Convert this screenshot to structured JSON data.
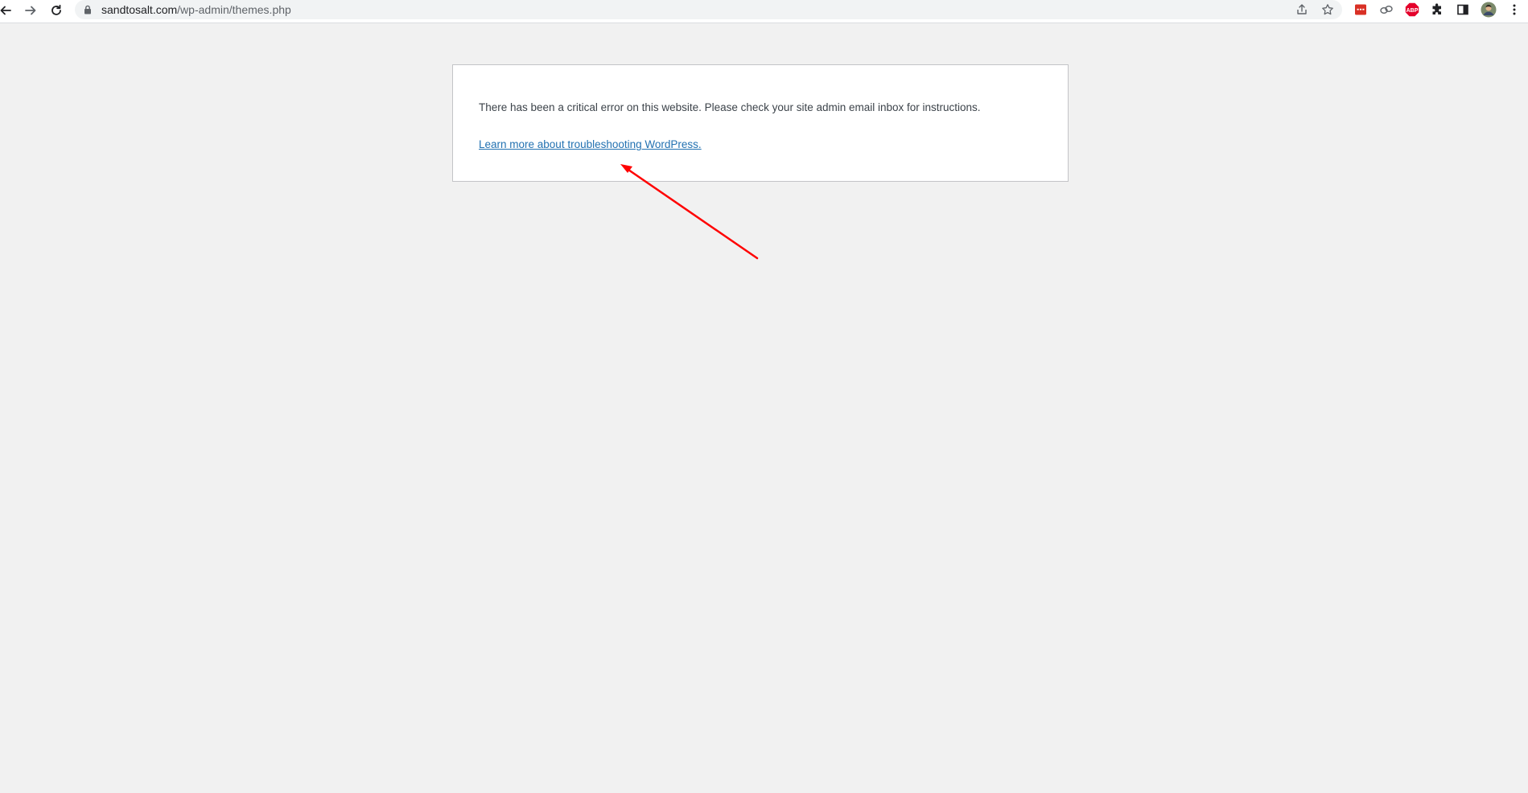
{
  "browser": {
    "url_domain": "sandtosalt.com",
    "url_path": "/wp-admin/themes.php",
    "icons": {
      "back": "back-arrow-icon",
      "forward": "forward-arrow-icon",
      "reload": "reload-icon",
      "lock": "lock-icon",
      "share": "share-icon",
      "bookmark": "star-icon",
      "extension_1": "red-extension-icon",
      "extension_2": "link-extension-icon",
      "extension_3": "abp-icon",
      "extensions": "puzzle-icon",
      "side_panel": "side-panel-icon",
      "profile": "profile-avatar",
      "menu": "kebab-menu-icon"
    },
    "abp_label": "ABP"
  },
  "error": {
    "message": "There has been a critical error on this website. Please check your site admin email inbox for instructions.",
    "link_text": "Learn more about troubleshooting WordPress."
  },
  "colors": {
    "page_bg": "#f1f1f1",
    "link": "#2271b1",
    "text": "#3c434a",
    "arrow": "#ff0000"
  }
}
